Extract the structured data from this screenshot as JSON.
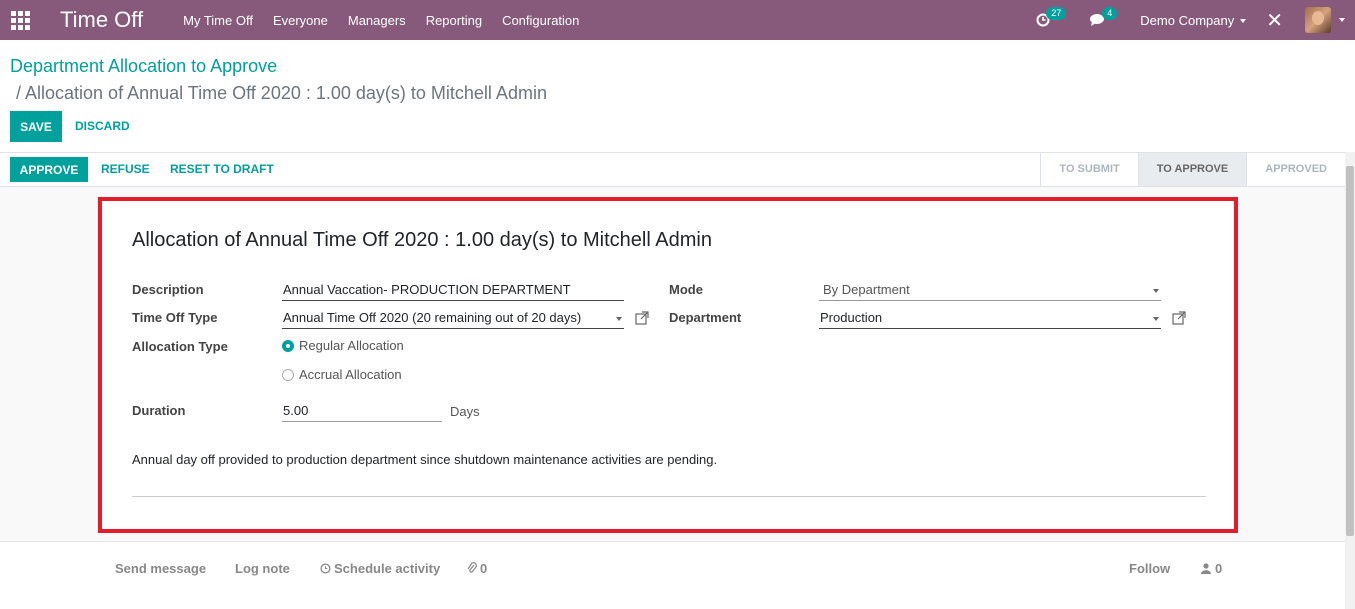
{
  "navbar": {
    "app_title": "Time Off",
    "menu": [
      "My Time Off",
      "Everyone",
      "Managers",
      "Reporting",
      "Configuration"
    ],
    "activity_count": "27",
    "message_count": "4",
    "company": "Demo Company",
    "bg_color": "#875a7b"
  },
  "breadcrumb": {
    "parent": "Department Allocation to Approve",
    "current": "/ Allocation of Annual Time Off 2020 : 1.00 day(s) to Mitchell Admin"
  },
  "buttons": {
    "save": "SAVE",
    "discard": "DISCARD",
    "approve": "APPROVE",
    "refuse": "REFUSE",
    "reset": "RESET TO DRAFT"
  },
  "stages": [
    "TO SUBMIT",
    "TO APPROVE",
    "APPROVED"
  ],
  "form": {
    "title": "Allocation of Annual Time Off 2020 : 1.00 day(s) to Mitchell Admin",
    "description_label": "Description",
    "description_value": "Annual Vaccation- PRODUCTION DEPARTMENT",
    "timeoff_type_label": "Time Off Type",
    "timeoff_type_value": "Annual Time Off 2020 (20 remaining out of 20 days)",
    "allocation_type_label": "Allocation Type",
    "allocation_regular": "Regular Allocation",
    "allocation_accrual": "Accrual Allocation",
    "duration_label": "Duration",
    "duration_value": "5.00",
    "duration_unit": "Days",
    "mode_label": "Mode",
    "mode_value": "By Department",
    "department_label": "Department",
    "department_value": "Production",
    "notes": "Annual day off provided to production department since shutdown maintenance activities are pending."
  },
  "chatter": {
    "send_message": "Send message",
    "log_note": "Log note",
    "schedule_activity": "Schedule activity",
    "attachments": "0",
    "follow": "Follow",
    "followers": "0"
  }
}
